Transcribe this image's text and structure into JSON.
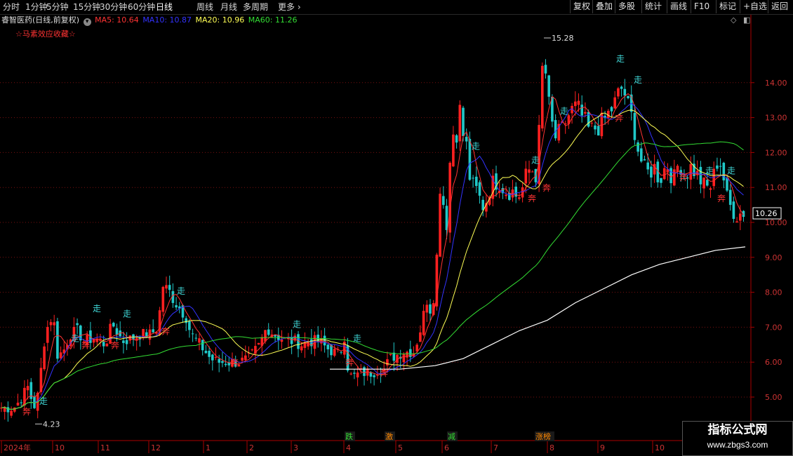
{
  "toolbar": {
    "periods": [
      "分时",
      "1分钟",
      "5分钟",
      "15分钟",
      "30分钟",
      "60分钟",
      "日线",
      "周线",
      "月线",
      "多周期",
      "更多"
    ],
    "active_period": "日线",
    "right_buttons": [
      "复权",
      "叠加",
      "多股",
      "统计",
      "画线",
      "F10",
      "标记",
      "+自选",
      "返回"
    ]
  },
  "legend": {
    "stock": "睿智医药(日线,前复权)",
    "ma5": "MA5: 10.64",
    "ma10": "MA10: 10.87",
    "ma20": "MA20: 10.96",
    "ma60": "MA60: 11.26",
    "indicator": "☆马素效应收藏☆",
    "colors": {
      "ma5": "#ff3333",
      "ma10": "#3333ff",
      "ma20": "#ffff55",
      "ma60": "#33dd33"
    }
  },
  "chart_data": {
    "type": "candlestick",
    "title": "睿智医药(日线,前复权)",
    "ylim": [
      4.6,
      15.5
    ],
    "y_ticks": [
      "14.00",
      "13.00",
      "12.00",
      "11.00",
      "10.00",
      "9.00",
      "8.00",
      "7.00",
      "6.00",
      "5.00"
    ],
    "current_price": "10.26",
    "high_label": "15.28",
    "low_label": "4.23",
    "x_labels": [
      "2024年",
      "10",
      "11",
      "12",
      "1",
      "2",
      "3",
      "4",
      "5",
      "6",
      "7",
      "8",
      "9",
      "10"
    ],
    "markers_walk": "走",
    "markers_run": "奔",
    "event_labels": [
      {
        "text": "跌",
        "color": "#33dd33"
      },
      {
        "text": "激",
        "color": "#ff8800"
      },
      {
        "text": "减",
        "color": "#33dd33"
      },
      {
        "text": "涨榜",
        "color": "#ff8800"
      }
    ],
    "anchor_close": [
      [
        0,
        4.7
      ],
      [
        20,
        4.7
      ],
      [
        28,
        4.9
      ],
      [
        40,
        5.3
      ],
      [
        48,
        4.7
      ],
      [
        55,
        5.1
      ],
      [
        62,
        6.5
      ],
      [
        70,
        7.2
      ],
      [
        76,
        7.3
      ],
      [
        82,
        6.2
      ],
      [
        90,
        6.3
      ],
      [
        100,
        6.8
      ],
      [
        110,
        6.9
      ],
      [
        120,
        6.6
      ],
      [
        135,
        6.7
      ],
      [
        150,
        6.5
      ],
      [
        160,
        7.1
      ],
      [
        175,
        6.6
      ],
      [
        190,
        6.7
      ],
      [
        200,
        6.8
      ],
      [
        215,
        6.8
      ],
      [
        225,
        7.0
      ],
      [
        232,
        8.2
      ],
      [
        242,
        8.0
      ],
      [
        250,
        7.7
      ],
      [
        258,
        7.5
      ],
      [
        265,
        7.3
      ],
      [
        272,
        6.8
      ],
      [
        285,
        6.5
      ],
      [
        300,
        6.1
      ],
      [
        310,
        6.0
      ],
      [
        325,
        6.0
      ],
      [
        340,
        6.0
      ],
      [
        355,
        6.1
      ],
      [
        370,
        6.5
      ],
      [
        380,
        7.0
      ],
      [
        390,
        6.8
      ],
      [
        400,
        6.7
      ],
      [
        410,
        6.6
      ],
      [
        420,
        6.6
      ],
      [
        430,
        6.5
      ],
      [
        440,
        6.6
      ],
      [
        455,
        6.6
      ],
      [
        465,
        6.4
      ],
      [
        475,
        6.3
      ],
      [
        485,
        6.2
      ],
      [
        490,
        6.9
      ],
      [
        497,
        5.6
      ],
      [
        505,
        5.6
      ],
      [
        515,
        5.7
      ],
      [
        530,
        5.7
      ],
      [
        540,
        5.8
      ],
      [
        548,
        5.8
      ],
      [
        555,
        6.1
      ],
      [
        565,
        6.2
      ],
      [
        575,
        6.3
      ],
      [
        590,
        6.3
      ],
      [
        600,
        7.0
      ],
      [
        608,
        7.8
      ],
      [
        615,
        7.4
      ],
      [
        620,
        8.3
      ],
      [
        624,
        9.5
      ],
      [
        628,
        11.5
      ],
      [
        632,
        10.5
      ],
      [
        638,
        9.8
      ],
      [
        643,
        12.8
      ],
      [
        648,
        12.4
      ],
      [
        652,
        12.7
      ],
      [
        656,
        13.3
      ],
      [
        660,
        12.5
      ],
      [
        664,
        12.3
      ],
      [
        670,
        11.2
      ],
      [
        675,
        11.0
      ],
      [
        680,
        10.9
      ],
      [
        685,
        10.6
      ],
      [
        690,
        10.4
      ],
      [
        695,
        10.8
      ],
      [
        700,
        11.1
      ],
      [
        710,
        11.2
      ],
      [
        720,
        10.9
      ],
      [
        730,
        10.9
      ],
      [
        738,
        10.7
      ],
      [
        745,
        11.0
      ],
      [
        752,
        11.5
      ],
      [
        760,
        11.5
      ],
      [
        765,
        11.3
      ],
      [
        770,
        13.3
      ],
      [
        775,
        15.2
      ],
      [
        779,
        13.7
      ],
      [
        785,
        13.0
      ],
      [
        790,
        12.4
      ],
      [
        800,
        12.6
      ],
      [
        808,
        13.0
      ],
      [
        815,
        13.2
      ],
      [
        822,
        13.3
      ],
      [
        830,
        13.0
      ],
      [
        840,
        12.6
      ],
      [
        848,
        12.7
      ],
      [
        856,
        12.8
      ],
      [
        864,
        13.0
      ],
      [
        870,
        13.2
      ],
      [
        876,
        13.4
      ],
      [
        882,
        13.7
      ],
      [
        888,
        13.9
      ],
      [
        893,
        13.4
      ],
      [
        897,
        13.2
      ],
      [
        903,
        12.8
      ],
      [
        910,
        12.0
      ],
      [
        918,
        11.5
      ],
      [
        925,
        11.4
      ],
      [
        932,
        11.6
      ],
      [
        940,
        11.2
      ],
      [
        950,
        11.7
      ],
      [
        960,
        11.2
      ],
      [
        968,
        11.8
      ],
      [
        975,
        11.3
      ],
      [
        985,
        11.6
      ],
      [
        995,
        11.3
      ],
      [
        1005,
        11.0
      ],
      [
        1012,
        11.0
      ],
      [
        1018,
        11.4
      ],
      [
        1024,
        11.9
      ],
      [
        1030,
        11.4
      ],
      [
        1036,
        10.7
      ],
      [
        1042,
        10.4
      ],
      [
        1050,
        10.2
      ],
      [
        1058,
        10.3
      ],
      [
        1063,
        10.26
      ]
    ],
    "anchor_long_ma": [
      [
        470,
        5.8
      ],
      [
        520,
        5.8
      ],
      [
        570,
        5.8
      ],
      [
        620,
        5.9
      ],
      [
        660,
        6.1
      ],
      [
        700,
        6.5
      ],
      [
        740,
        6.9
      ],
      [
        780,
        7.2
      ],
      [
        820,
        7.7
      ],
      [
        860,
        8.1
      ],
      [
        900,
        8.5
      ],
      [
        940,
        8.8
      ],
      [
        980,
        9.0
      ],
      [
        1020,
        9.2
      ],
      [
        1062,
        9.3
      ]
    ]
  }
}
